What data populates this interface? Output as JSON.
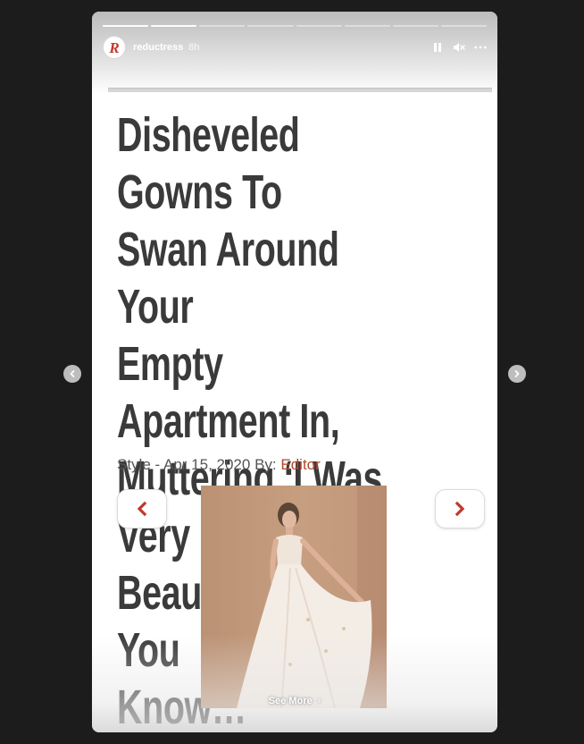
{
  "story": {
    "username": "reductress",
    "time": "8h",
    "avatar_letter": "R",
    "progress_segments": 8,
    "progress_completed": 2
  },
  "article": {
    "headline": "Disheveled Gowns To\nSwan Around Your\nEmpty Apartment In,\nMuttering ‘I Was Very\nBeautiful Once, You\nKnow…’",
    "category": "Style",
    "date": "Apr 15, 2020",
    "by_label": "By:",
    "author": "Editor"
  },
  "footer": {
    "see_more": "See More"
  },
  "icons": {
    "pause": "pause-icon",
    "mute": "mute-icon",
    "more": "more-icon",
    "prev": "chevron-left-icon",
    "next": "chevron-right-icon"
  },
  "colors": {
    "accent_red": "#c0392b",
    "author_link": "#b5482f",
    "headline": "#3a3a3a",
    "background": "#1c1c1c"
  }
}
